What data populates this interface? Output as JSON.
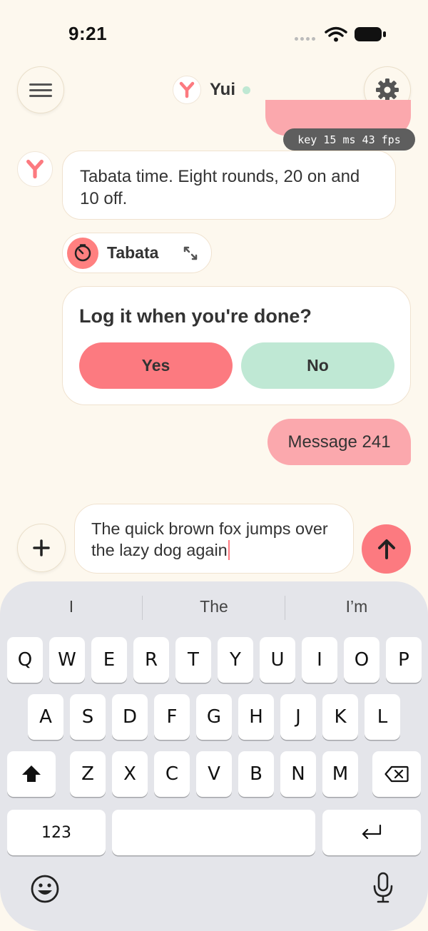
{
  "status_bar": {
    "time": "9:21"
  },
  "header": {
    "name": "Yui",
    "menu_icon": "hamburger-icon",
    "settings_icon": "gear-icon",
    "online_color": "#bfe8d3"
  },
  "debug_badge": "key 15 ms 43 fps",
  "messages": {
    "bot_text": "Tabata time. Eight rounds, 20 on and 10 off.",
    "timer_label": "Tabata",
    "card_title": "Log it when you're done?",
    "yes_label": "Yes",
    "no_label": "No",
    "user_text": "Message 241"
  },
  "composer": {
    "text": "The quick brown fox jumps over the lazy dog again"
  },
  "keyboard": {
    "suggestions": [
      "I",
      "The",
      "I’m"
    ],
    "row1": [
      "Q",
      "W",
      "E",
      "R",
      "T",
      "Y",
      "U",
      "I",
      "O",
      "P"
    ],
    "row2": [
      "A",
      "S",
      "D",
      "F",
      "G",
      "H",
      "J",
      "K",
      "L"
    ],
    "row3": [
      "Z",
      "X",
      "C",
      "V",
      "B",
      "N",
      "M"
    ],
    "numbers_label": "123"
  },
  "colors": {
    "accent": "#fc7a80",
    "user_bubble": "#fba8ad",
    "no_button": "#bfe8d4",
    "background": "#fdf8ee"
  }
}
